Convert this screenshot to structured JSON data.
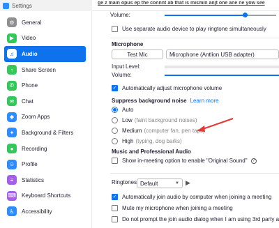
{
  "window": {
    "title": "Settings",
    "bleed_text": "ge z main opus ep the connnt ab that is mismin anjt one ane ne yow see"
  },
  "sidebar": {
    "items": [
      {
        "label": "General",
        "icon": "gear-icon",
        "color": "#8e8e93",
        "glyph": "⚙"
      },
      {
        "label": "Video",
        "icon": "video-icon",
        "color": "#34c759",
        "glyph": "▶"
      },
      {
        "label": "Audio",
        "icon": "headphones-icon",
        "color": "#0e72ed",
        "glyph": "♫",
        "active": true
      },
      {
        "label": "Share Screen",
        "icon": "share-screen-icon",
        "color": "#34c759",
        "glyph": "↑"
      },
      {
        "label": "Phone",
        "icon": "phone-icon",
        "color": "#34c759",
        "glyph": "✆"
      },
      {
        "label": "Chat",
        "icon": "chat-icon",
        "color": "#34c759",
        "glyph": "✉"
      },
      {
        "label": "Zoom Apps",
        "icon": "apps-icon",
        "color": "#2d8cff",
        "glyph": "◆"
      },
      {
        "label": "Background & Filters",
        "icon": "background-icon",
        "color": "#2d8cff",
        "glyph": "✦"
      },
      {
        "label": "Recording",
        "icon": "recording-icon",
        "color": "#34c759",
        "glyph": "●"
      },
      {
        "label": "Profile",
        "icon": "profile-icon",
        "color": "#2d8cff",
        "glyph": "☺"
      },
      {
        "label": "Statistics",
        "icon": "statistics-icon",
        "color": "#a55eea",
        "glyph": "≡"
      },
      {
        "label": "Keyboard Shortcuts",
        "icon": "keyboard-icon",
        "color": "#a55eea",
        "glyph": "⌨"
      },
      {
        "label": "Accessibility",
        "icon": "accessibility-icon",
        "color": "#2d8cff",
        "glyph": "♿"
      }
    ]
  },
  "speaker": {
    "volume_label": "Volume:",
    "volume_level": 0.72
  },
  "ringtone_option": {
    "label": "Use separate audio device to play ringtone simultaneously",
    "checked": false
  },
  "microphone": {
    "heading": "Microphone",
    "test_button": "Test Mic",
    "device": "Microphone (Antlion USB adapter)",
    "input_level_label": "Input Level:",
    "volume_label": "Volume:",
    "auto_adjust_label": "Automatically adjust microphone volume",
    "auto_adjust_checked": true
  },
  "noise": {
    "heading": "Suppress background noise",
    "learn_more": "Learn more",
    "options": [
      {
        "label": "Auto",
        "hint": "",
        "checked": true
      },
      {
        "label": "Low",
        "hint": "(faint background noises)",
        "checked": false
      },
      {
        "label": "Medium",
        "hint": "(computer fan, pen taps)",
        "checked": false
      },
      {
        "label": "High",
        "hint": "(typing, dog barks)",
        "checked": false
      }
    ]
  },
  "music": {
    "heading": "Music and Professional Audio",
    "original_sound_label": "Show in-meeting option to enable \"Original Sound\"",
    "checked": false
  },
  "ringtones": {
    "label": "Ringtones",
    "value": "Default"
  },
  "meeting_options": [
    {
      "label": "Automatically join audio by computer when joining a meeting",
      "checked": true
    },
    {
      "label": "Mute my microphone when joining a meeting",
      "checked": false
    },
    {
      "label": "Do not prompt the join audio dialog when I am using 3rd party audio",
      "checked": false
    }
  ],
  "colors": {
    "accent": "#0e72ed",
    "annotation_arrow": "#e53935"
  }
}
